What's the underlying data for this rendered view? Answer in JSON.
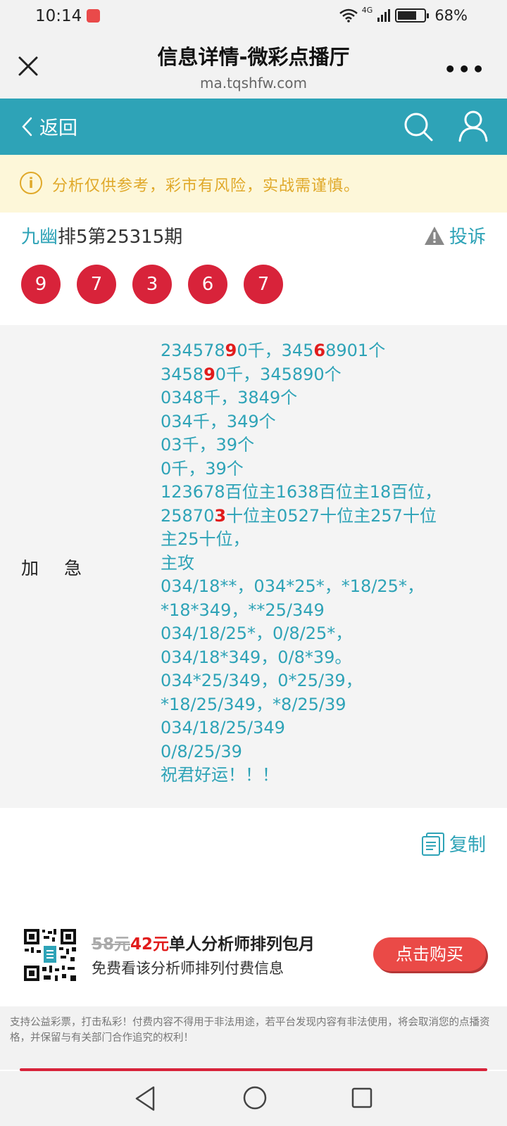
{
  "status_bar": {
    "time": "10:14",
    "network": "4G",
    "battery": "68%"
  },
  "browser": {
    "title": "信息详情-微彩点播厅",
    "url": "ma.tqshfw.com"
  },
  "nav": {
    "back_label": "返回"
  },
  "warning": {
    "text": "分析仅供参考，彩市有风险，实战需谨慎。"
  },
  "issue": {
    "name": "九幽",
    "rest": "排5第25315期",
    "complain_label": "投诉"
  },
  "balls": [
    "9",
    "7",
    "3",
    "6",
    "7"
  ],
  "content": {
    "label": "加急",
    "lines": [
      [
        "234578",
        "9",
        "0千，345",
        "6",
        "8901个"
      ],
      [
        "3458",
        "9",
        "0千，345890个"
      ],
      [
        "0348千，3849个"
      ],
      [
        "034千，349个"
      ],
      [
        "03千，39个"
      ],
      [
        "0千，39个"
      ],
      [
        "12367",
        "8百位主1638百位主18百位，"
      ],
      [
        "25870",
        "3",
        "十位主0527十位主257十位"
      ],
      [
        "主25十位，"
      ],
      [
        "主攻"
      ],
      [
        "034/18**，034*25*，*18/25*，"
      ],
      [
        "*18*349，**25/349"
      ],
      [
        "034/18/25*，0/8/25*，"
      ],
      [
        "034/18*349，0/8*39。"
      ],
      [
        "034*25/349，0*25/39，"
      ],
      [
        "*18/25/349，*8/25/39"
      ],
      [
        "034/18/25/349"
      ],
      [
        "0/8/25/39"
      ],
      [
        "祝君好运！！！"
      ]
    ]
  },
  "copy_label": "复制",
  "promo": {
    "old_price": "58元",
    "new_price": "42元",
    "title": "单人分析师排列包月",
    "subtitle": "免费看该分析师排列付费信息",
    "buy_label": "点击购买"
  },
  "disclaimer": "支持公益彩票，打击私彩！付费内容不得用于非法用途，若平台发现内容有非法使用，将会取消您的点播资格，并保留与有关部门合作追究的权利！",
  "colors": {
    "teal": "#2ea3b7",
    "red": "#d8233a",
    "warning_bg": "#fdf7d9",
    "warning_text": "#e0a92a"
  }
}
